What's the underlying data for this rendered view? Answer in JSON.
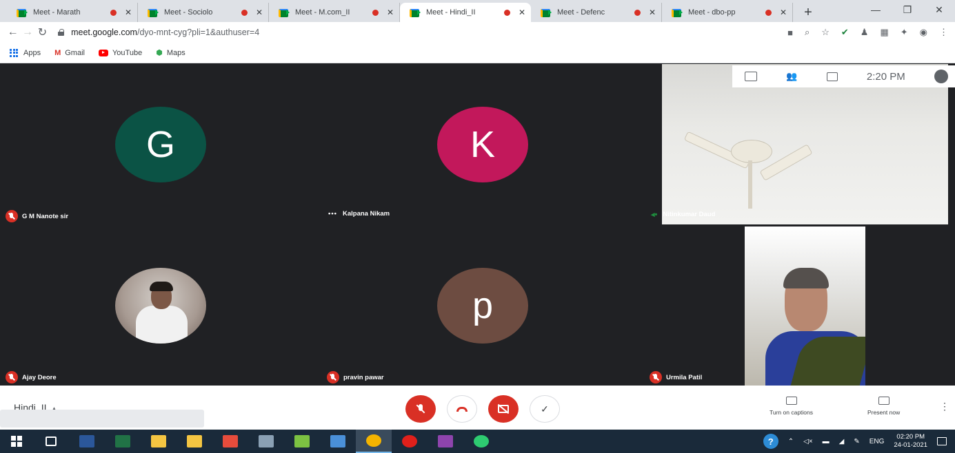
{
  "browser": {
    "tabs": [
      {
        "title": "Meet - Marath",
        "recording": true,
        "active": false
      },
      {
        "title": "Meet - Sociolo",
        "recording": true,
        "active": false
      },
      {
        "title": "Meet - M.com_II",
        "recording": true,
        "active": false
      },
      {
        "title": "Meet - Hindi_II",
        "recording": true,
        "active": true
      },
      {
        "title": "Meet - Defenc",
        "recording": true,
        "active": false
      },
      {
        "title": "Meet - dbo-pp",
        "recording": true,
        "active": false
      }
    ],
    "new_tab_icon": "plus-icon",
    "url_domain": "meet.google.com",
    "url_path": "/dyo-mnt-cyg?pli=1&authuser=4",
    "bookmarks": [
      {
        "label": "Apps",
        "icon": "apps-grid-icon"
      },
      {
        "label": "Gmail",
        "icon": "gmail-icon"
      },
      {
        "label": "YouTube",
        "icon": "youtube-icon"
      },
      {
        "label": "Maps",
        "icon": "maps-icon"
      }
    ]
  },
  "meet": {
    "time": "2:20 PM",
    "participants": [
      {
        "name": "G M Nanote sir",
        "initial": "G",
        "color": "#0b5345",
        "muted": true
      },
      {
        "name": "Kalpana Nikam",
        "initial": "K",
        "color": "#c2185b",
        "muted": false
      },
      {
        "name": "Nitinkumar Daud",
        "initial": "",
        "muted": false,
        "talking": true
      },
      {
        "name": "Ajay Deore",
        "initial": "",
        "muted": true
      },
      {
        "name": "pravin pawar",
        "initial": "p",
        "color": "#6d4c41",
        "muted": true
      },
      {
        "name": "Urmila Patil",
        "initial": "",
        "muted": true
      }
    ],
    "meeting_name": "Hindi_II",
    "controls": {
      "captions_label": "Turn on captions",
      "present_label": "Present now"
    }
  },
  "taskbar": {
    "language": "ENG",
    "time": "02:20 PM",
    "date": "24-01-2021",
    "apps": [
      {
        "name": "task-view",
        "color": "#ffffff"
      },
      {
        "name": "word",
        "color": "#2b579a"
      },
      {
        "name": "excel",
        "color": "#217346"
      },
      {
        "name": "security",
        "color": "#f4c542"
      },
      {
        "name": "file-explorer",
        "color": "#f4c542"
      },
      {
        "name": "recorder",
        "color": "#e74c3c"
      },
      {
        "name": "app-7",
        "color": "#8aa0b4"
      },
      {
        "name": "app-8",
        "color": "#7cc242"
      },
      {
        "name": "app-9",
        "color": "#4a90d9"
      },
      {
        "name": "chrome",
        "color": "#f4b400"
      },
      {
        "name": "opera",
        "color": "#e0201b"
      },
      {
        "name": "app-12",
        "color": "#8e44ad"
      },
      {
        "name": "edge",
        "color": "#2ecc71"
      }
    ]
  }
}
